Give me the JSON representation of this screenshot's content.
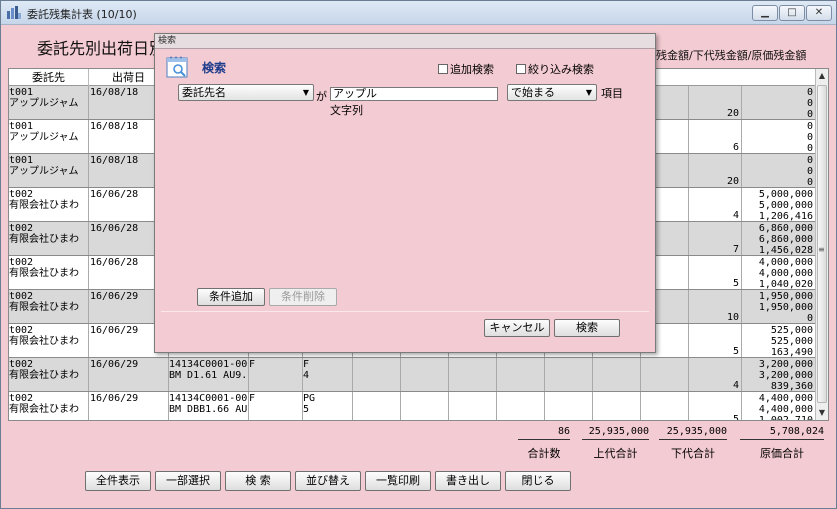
{
  "window": {
    "title": "委託残集計表 (10/10)",
    "controls": [
      "▁",
      "□",
      "✕"
    ]
  },
  "heading": "委託先別出荷日別",
  "heading_right": "残金額/下代残金額/原価残金額",
  "columns": [
    "委託先",
    "出荷日"
  ],
  "rows": [
    {
      "code": "t001",
      "name": "アップルジャム",
      "date": "16/08/18",
      "item": [
        "",
        ""
      ],
      "f1": "",
      "f2": [
        "",
        ""
      ],
      "qty": "20",
      "amounts": [
        "0",
        "0",
        "0"
      ]
    },
    {
      "code": "t001",
      "name": "アップルジャム",
      "date": "16/08/18",
      "item": [
        "",
        ""
      ],
      "f1": "",
      "f2": [
        "",
        ""
      ],
      "qty": "6",
      "amounts": [
        "0",
        "0",
        "0"
      ]
    },
    {
      "code": "t001",
      "name": "アップルジャム",
      "date": "16/08/18",
      "item": [
        "",
        ""
      ],
      "f1": "",
      "f2": [
        "",
        ""
      ],
      "qty": "20",
      "amounts": [
        "0",
        "0",
        "0"
      ]
    },
    {
      "code": "t002",
      "name": "有限会社ひまわ",
      "date": "16/06/28",
      "item": [
        "",
        ""
      ],
      "f1": "",
      "f2": [
        "",
        ""
      ],
      "qty": "4",
      "amounts": [
        "5,000,000",
        "5,000,000",
        "1,206,416"
      ]
    },
    {
      "code": "t002",
      "name": "有限会社ひまわ",
      "date": "16/06/28",
      "item": [
        "",
        ""
      ],
      "f1": "",
      "f2": [
        "",
        ""
      ],
      "qty": "7",
      "amounts": [
        "6,860,000",
        "6,860,000",
        "1,456,028"
      ]
    },
    {
      "code": "t002",
      "name": "有限会社ひまわ",
      "date": "16/06/28",
      "item": [
        "",
        ""
      ],
      "f1": "",
      "f2": [
        "",
        ""
      ],
      "qty": "5",
      "amounts": [
        "4,000,000",
        "4,000,000",
        "1,040,020"
      ]
    },
    {
      "code": "t002",
      "name": "有限会社ひまわ",
      "date": "16/06/29",
      "item": [
        "",
        ""
      ],
      "f1": "",
      "f2": [
        "",
        ""
      ],
      "qty": "10",
      "amounts": [
        "1,950,000",
        "1,950,000",
        "0"
      ]
    },
    {
      "code": "t002",
      "name": "有限会社ひまわ",
      "date": "16/06/29",
      "item": [
        "",
        ""
      ],
      "f1": "",
      "f2": [
        "",
        ""
      ],
      "qty": "5",
      "amounts": [
        "525,000",
        "525,000",
        "163,490"
      ]
    },
    {
      "code": "t002",
      "name": "有限会社ひまわ",
      "date": "16/06/29",
      "item": [
        "14134C0001-00",
        "BM D1.61 AU9."
      ],
      "f1": "F",
      "f2": [
        "F",
        "4"
      ],
      "qty": "4",
      "amounts": [
        "3,200,000",
        "3,200,000",
        "839,360"
      ]
    },
    {
      "code": "t002",
      "name": "有限会社ひまわ",
      "date": "16/06/29",
      "item": [
        "14134C0001-00",
        "BM DBB1.66 AU"
      ],
      "f1": "F",
      "f2": [
        "PG",
        "5"
      ],
      "qty": "5",
      "amounts": [
        "4,400,000",
        "4,400,000",
        "1,002,710"
      ]
    }
  ],
  "totals": {
    "count": "86",
    "count_label": "合計数",
    "upper": "25,935,000",
    "upper_label": "上代合計",
    "lower": "25,935,000",
    "lower_label": "下代合計",
    "cost": "5,708,024",
    "cost_label": "原価合計"
  },
  "buttons": [
    "全件表示",
    "一部選択",
    "検 索",
    "並び替え",
    "一覧印刷",
    "書き出し",
    "閉じる"
  ],
  "dialog": {
    "title": "検索",
    "label": "検索",
    "add_search": "追加検索",
    "narrow_search": "絞り込み検索",
    "field": "委託先名",
    "ga": "が",
    "value": "アップル",
    "value_type": "文字列",
    "operator": "で始まる",
    "item_label": "項目",
    "add_condition": "条件追加",
    "remove_condition": "条件削除",
    "cancel": "キャンセル",
    "search": "検索"
  },
  "colors": {
    "background": "#f3cbd2",
    "alt_row": "#d9d9d9",
    "dialog_label": "#1e3c8c"
  }
}
